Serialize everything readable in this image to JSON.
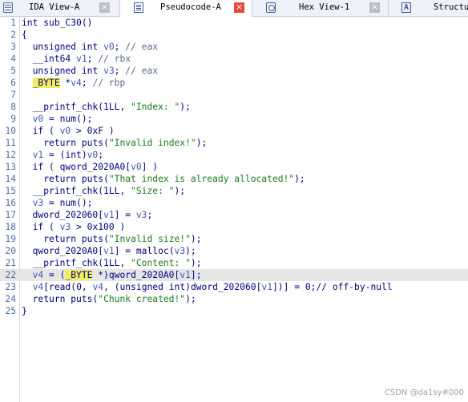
{
  "tabs": [
    {
      "label": "IDA View-A",
      "icon": "ida-view-icon",
      "active": false
    },
    {
      "label": "Pseudocode-A",
      "icon": "pseudocode-icon",
      "active": true
    },
    {
      "label": "Hex View-1",
      "icon": "hex-view-icon",
      "active": false
    },
    {
      "label": "Structu",
      "icon": "structures-icon",
      "glyph": "A",
      "active": false
    }
  ],
  "close_glyph": "×",
  "code": {
    "highlighted_line": 22,
    "lines": [
      {
        "n": "1",
        "t": "int sub_C30()"
      },
      {
        "n": "2",
        "t": "{"
      },
      {
        "n": "3",
        "t": "  unsigned int v0; // eax"
      },
      {
        "n": "4",
        "t": "  __int64 v1; // rbx"
      },
      {
        "n": "5",
        "t": "  unsigned int v3; // eax"
      },
      {
        "n": "6",
        "t": "  _BYTE *v4; // rbp"
      },
      {
        "n": "7",
        "t": ""
      },
      {
        "n": "8",
        "t": "  __printf_chk(1LL, \"Index: \");"
      },
      {
        "n": "9",
        "t": "  v0 = num();"
      },
      {
        "n": "10",
        "t": "  if ( v0 > 0xF )"
      },
      {
        "n": "11",
        "t": "    return puts(\"Invalid index!\");"
      },
      {
        "n": "12",
        "t": "  v1 = (int)v0;"
      },
      {
        "n": "13",
        "t": "  if ( qword_2020A0[v0] )"
      },
      {
        "n": "14",
        "t": "    return puts(\"That index is already allocated!\");"
      },
      {
        "n": "15",
        "t": "  __printf_chk(1LL, \"Size: \");"
      },
      {
        "n": "16",
        "t": "  v3 = num();"
      },
      {
        "n": "17",
        "t": "  dword_202060[v1] = v3;"
      },
      {
        "n": "18",
        "t": "  if ( v3 > 0x100 )"
      },
      {
        "n": "19",
        "t": "    return puts(\"Invalid size!\");"
      },
      {
        "n": "20",
        "t": "  qword_2020A0[v1] = malloc(v3);"
      },
      {
        "n": "21",
        "t": "  __printf_chk(1LL, \"Content: \");"
      },
      {
        "n": "22",
        "t": "  v4 = (_BYTE *)qword_2020A0[v1];"
      },
      {
        "n": "23",
        "t": "  v4[read(0, v4, (unsigned int)dword_202060[v1])] = 0;// off-by-null"
      },
      {
        "n": "24",
        "t": "  return puts(\"Chunk created!\");"
      },
      {
        "n": "25",
        "t": "}"
      }
    ]
  },
  "watermark": "CSDN @da1sy#000"
}
